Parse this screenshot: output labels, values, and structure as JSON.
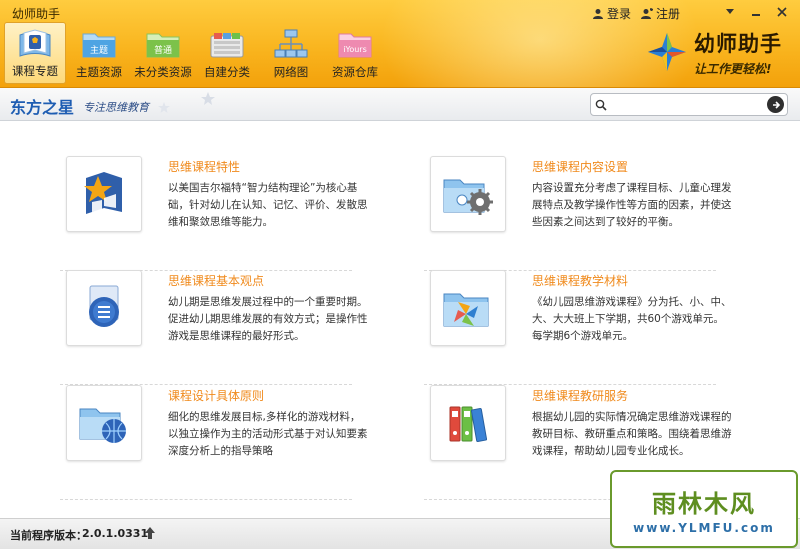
{
  "window": {
    "title": "幼师助手",
    "login_label": "登录",
    "register_label": "注册",
    "menu_icon": "dropdown-triangle",
    "minimize_icon": "minimize",
    "close_icon": "close-x"
  },
  "toolbar": {
    "items": [
      {
        "label": "课程专题",
        "icon": "course-topic-icon",
        "active": true
      },
      {
        "label": "主题资源",
        "icon": "theme-resource-icon",
        "badge": "主题",
        "active": false
      },
      {
        "label": "未分类资源",
        "icon": "uncategorized-resource-icon",
        "badge": "普通",
        "active": false
      },
      {
        "label": "自建分类",
        "icon": "custom-category-icon",
        "active": false
      },
      {
        "label": "网络图",
        "icon": "network-map-icon",
        "active": false
      },
      {
        "label": "资源仓库",
        "icon": "resource-store-icon",
        "badge": "iYours",
        "active": false
      }
    ]
  },
  "brand": {
    "name": "幼师助手",
    "slogan": "让工作更轻松!"
  },
  "subheader": {
    "org_name": "东方之星",
    "org_slogan": "专注思维教育",
    "search_placeholder": "",
    "search_value": ""
  },
  "cards": [
    {
      "title": "思维课程特性",
      "desc": "以美国吉尔福特“智力结构理论”为核心基础，针对幼儿在认知、记忆、评价、发散思维和聚敛思维等能力。",
      "icon": "star-puzzle-icon"
    },
    {
      "title": "思维课程内容设置",
      "desc": "内容设置充分考虑了课程目标、儿童心理发展特点及教学操作性等方面的因素，并使这些因素之间达到了较好的平衡。",
      "icon": "folder-gear-icon"
    },
    {
      "title": "思维课程基本观点",
      "desc": "幼儿期是思维发展过程中的一个重要时期。促进幼儿期思维发展的有效方式；是操作性游戏是思维课程的最好形式。",
      "icon": "document-chat-icon"
    },
    {
      "title": "思维课程教学材料",
      "desc": "《幼儿园思维游戏课程》分为托、小、中、大、大大班上下学期，共60个游戏单元。每学期6个游戏单元。",
      "icon": "folder-pinwheel-icon"
    },
    {
      "title": "课程设计具体原则",
      "desc": "细化的思维发展目标,多样化的游戏材料，以独立操作为主的活动形式基于对认知要素深度分析上的指导策略",
      "icon": "folder-globe-icon"
    },
    {
      "title": "思维课程教研服务",
      "desc": "根据幼儿园的实际情况确定思维游戏课程的教研目标、教研重点和策略。围绕着思维游戏课程，帮助幼儿园专业化成长。",
      "icon": "binders-icon"
    }
  ],
  "status": {
    "version_label": "当前程序版本：",
    "version_value": "2.0.1.0331",
    "update_icon": "up-arrow"
  },
  "watermark": {
    "main_text": "雨林木风",
    "url": "www.YLMFU.com"
  },
  "colors": {
    "toolbar_orange": "#f9b51f",
    "card_title": "#f08a1c",
    "org_blue": "#1e5db2",
    "watermark_green": "#5e8e20"
  }
}
